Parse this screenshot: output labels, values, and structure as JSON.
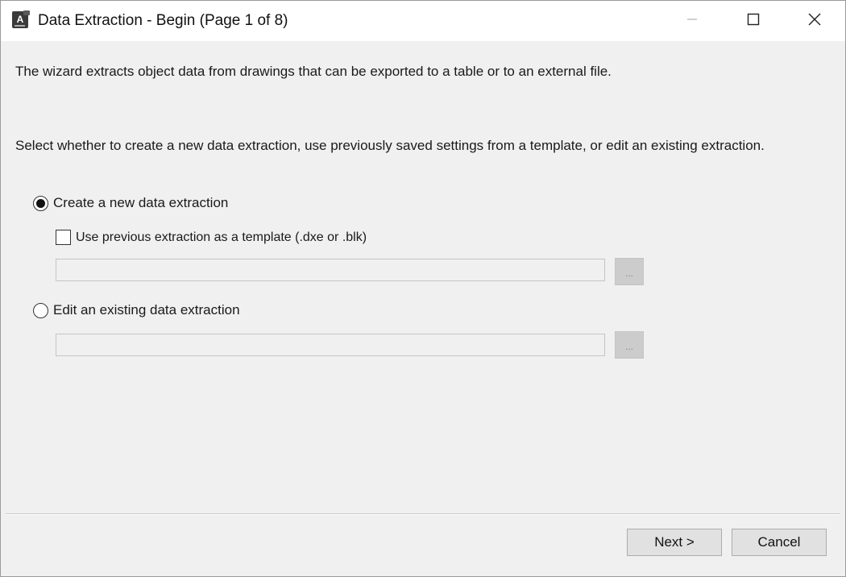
{
  "window": {
    "title": "Data Extraction - Begin (Page 1 of 8)",
    "icon": "autocad-app-icon",
    "controls": [
      "minimize-icon",
      "maximize-icon",
      "close-icon"
    ]
  },
  "content": {
    "intro": "The wizard extracts object data from drawings that can be exported to a table or to an external file.",
    "instruction": "Select whether to create a new data extraction, use previously saved settings from a template, or edit an existing extraction.",
    "options": {
      "create_new": {
        "label": "Create a new data extraction",
        "selected": true
      },
      "use_template": {
        "label": "Use previous extraction as a template (.dxe or .blk)",
        "checked": false,
        "path_value": "",
        "browse_label": "..."
      },
      "edit_existing": {
        "label": "Edit an existing data extraction",
        "selected": false,
        "path_value": "",
        "browse_label": "..."
      }
    }
  },
  "footer": {
    "next_label": "Next >",
    "cancel_label": "Cancel"
  }
}
